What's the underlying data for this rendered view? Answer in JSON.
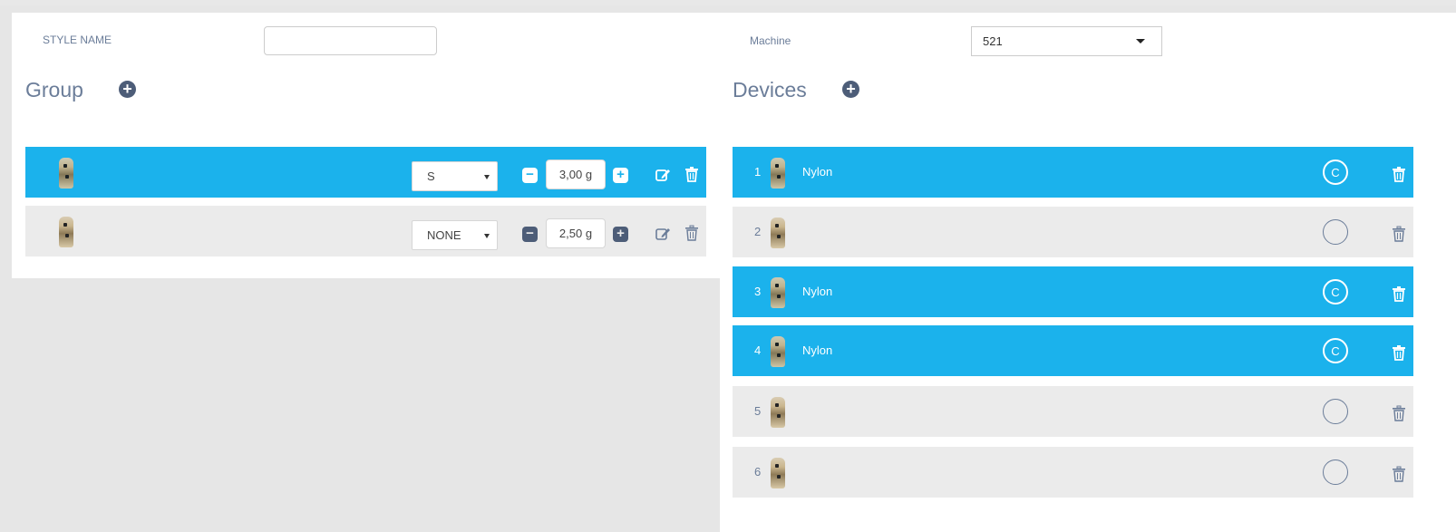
{
  "form": {
    "style_name_label": "STYLE NAME",
    "style_name_value": "",
    "machine_label": "Machine",
    "machine_value": "521"
  },
  "group": {
    "title": "Group",
    "rows": [
      {
        "state": "selected",
        "size": "S",
        "weight": "3,00  g"
      },
      {
        "state": "normal",
        "size": "NONE",
        "weight": "2,50  g"
      }
    ]
  },
  "devices": {
    "title": "Devices",
    "rows": [
      {
        "number": "1",
        "name": "Nylon",
        "state": "selected",
        "badge": "C"
      },
      {
        "number": "2",
        "name": "",
        "state": "normal",
        "badge": ""
      },
      {
        "number": "3",
        "name": "Nylon",
        "state": "selected",
        "badge": "C"
      },
      {
        "number": "4",
        "name": "Nylon",
        "state": "selected",
        "badge": "C"
      },
      {
        "number": "5",
        "name": "",
        "state": "normal",
        "badge": ""
      },
      {
        "number": "6",
        "name": "",
        "state": "normal",
        "badge": ""
      }
    ]
  },
  "colors": {
    "selected_row": "#1bb2ec",
    "normal_row": "#ebebeb",
    "icon_dark": "#4d5d78",
    "text_muted": "#6b7d99"
  },
  "icons": [
    "plus-circle-icon",
    "minus-square-icon",
    "plus-square-icon",
    "edit-icon",
    "trash-icon",
    "caret-down-icon",
    "thread-thumbnail-icon"
  ]
}
